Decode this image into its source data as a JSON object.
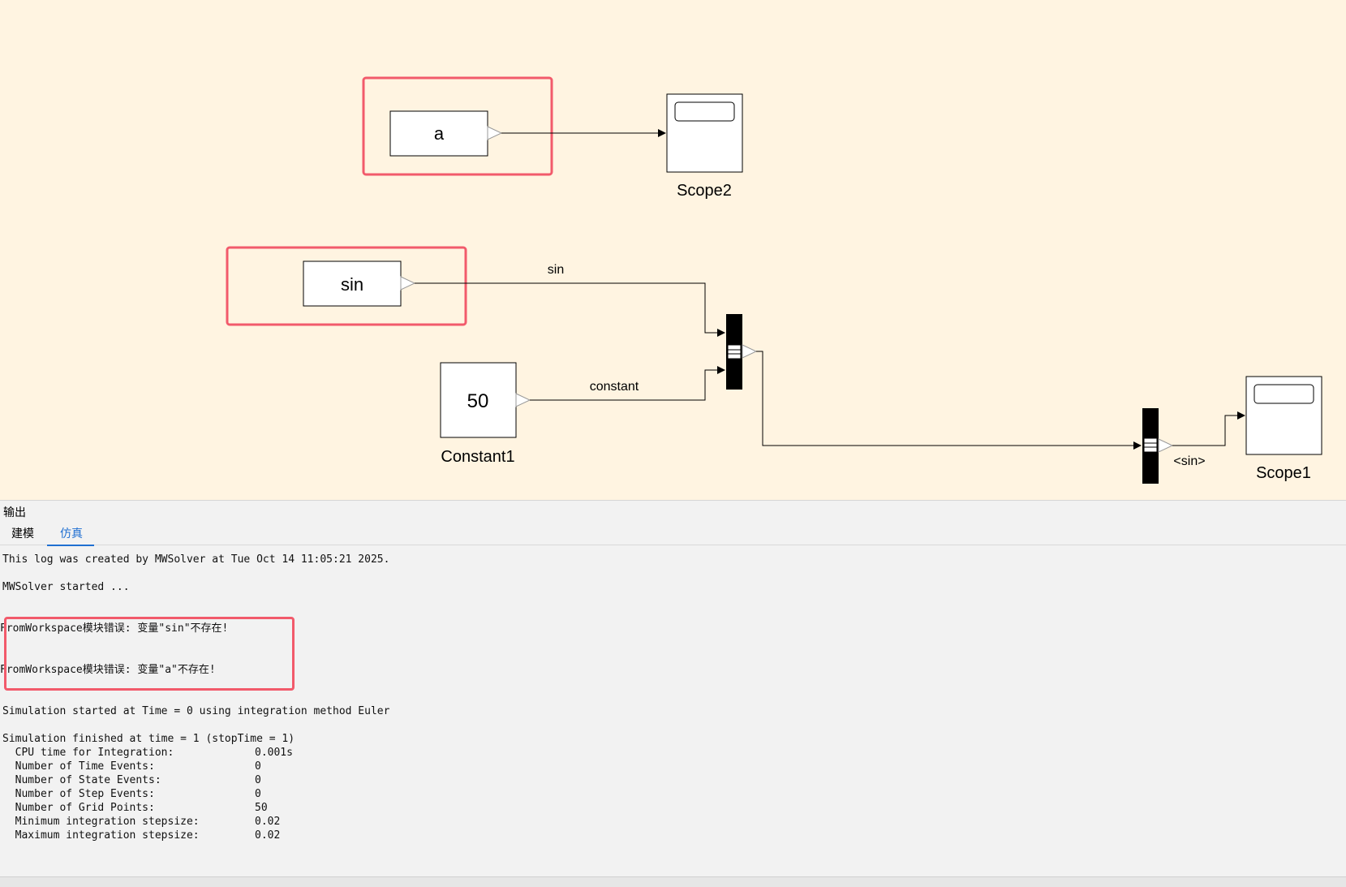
{
  "diagram": {
    "blocks": {
      "from_ws_a": "a",
      "from_ws_sin": "sin",
      "constant_value": "50",
      "constant_name": "Constant1",
      "scope2_name": "Scope2",
      "scope1_name": "Scope1"
    },
    "signals": {
      "sin_label": "sin",
      "constant_label": "constant",
      "selector_label": "<sin>"
    },
    "highlight_color": "#f25a6b",
    "canvas_color": "#fff4e1"
  },
  "output": {
    "title": "输出",
    "tabs": [
      "建模",
      "仿真"
    ],
    "active_tab": "仿真",
    "log": {
      "line1": "This log was created by MWSolver at Tue Oct 14 11:05:21 2025.",
      "line2": "MWSolver started ...",
      "error1": "FromWorkspace模块错误: 变量\"sin\"不存在!",
      "error2": "FromWorkspace模块错误: 变量\"a\"不存在!",
      "sim_start": "Simulation started at Time = 0 using integration method Euler",
      "sim_finish": "Simulation finished at time = 1 (stopTime = 1)",
      "stats": [
        {
          "label": "  CPU time for Integration:",
          "value": "0.001s"
        },
        {
          "label": "  Number of Time Events:",
          "value": "0"
        },
        {
          "label": "  Number of State Events:",
          "value": "0"
        },
        {
          "label": "  Number of Step Events:",
          "value": "0"
        },
        {
          "label": "  Number of Grid Points:",
          "value": "50"
        },
        {
          "label": "  Minimum integration stepsize:",
          "value": "0.02"
        },
        {
          "label": "  Maximum integration stepsize:",
          "value": "0.02"
        }
      ]
    }
  }
}
